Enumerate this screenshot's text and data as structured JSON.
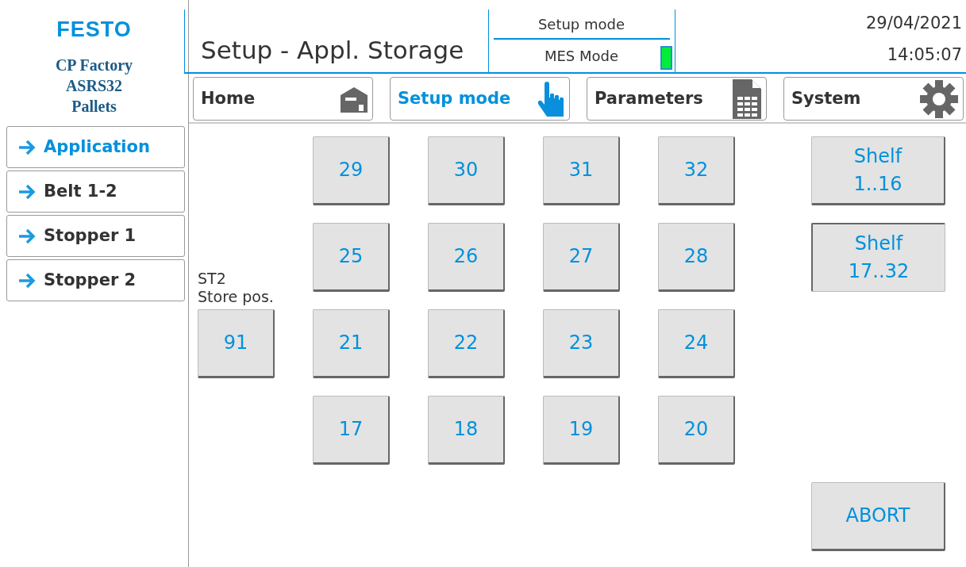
{
  "brand": {
    "logo": "FESTO",
    "lines": [
      "CP Factory",
      "ASRS32",
      "Pallets"
    ]
  },
  "header": {
    "title": "Setup - Appl. Storage",
    "mode": "Setup mode",
    "mes_label": "MES Mode",
    "mes_indicator": {
      "on": true
    },
    "date": "29/04/2021",
    "time": "14:05:07"
  },
  "nav_tabs": [
    {
      "label": "Home",
      "kind": "house",
      "selected": false
    },
    {
      "label": "Setup mode",
      "kind": "hand",
      "selected": true
    },
    {
      "label": "Parameters",
      "kind": "document",
      "selected": false
    },
    {
      "label": "System",
      "kind": "gear",
      "selected": false
    }
  ],
  "sidebar": {
    "items": [
      {
        "label": "Application",
        "selected": true
      },
      {
        "label": "Belt 1-2",
        "selected": false
      },
      {
        "label": "Stopper 1",
        "selected": false
      },
      {
        "label": "Stopper 2",
        "selected": false
      }
    ]
  },
  "store_position": {
    "label_lines": [
      "ST2",
      "Store pos."
    ],
    "button": "91"
  },
  "storage_grid": [
    [
      "29",
      "30",
      "31",
      "32"
    ],
    [
      "25",
      "26",
      "27",
      "28"
    ],
    [
      "21",
      "22",
      "23",
      "24"
    ],
    [
      "17",
      "18",
      "19",
      "20"
    ]
  ],
  "shelf_buttons": [
    {
      "label_lines": [
        "Shelf",
        "1..16"
      ],
      "selected": false
    },
    {
      "label_lines": [
        "Shelf",
        "17..32"
      ],
      "selected": true
    }
  ],
  "abort_button": "ABORT"
}
